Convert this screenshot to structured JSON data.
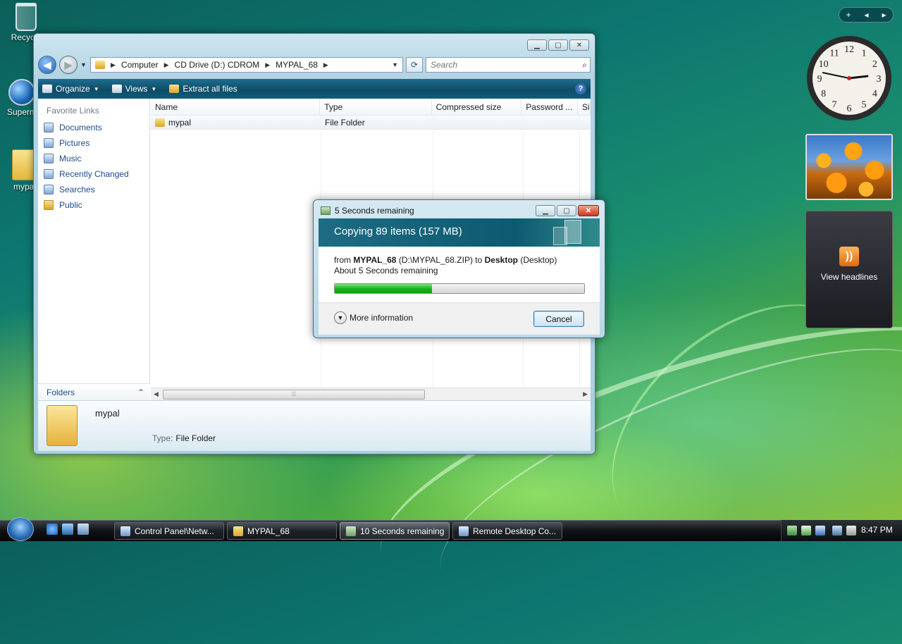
{
  "desktop": {
    "icons": [
      {
        "label": "Recycle"
      },
      {
        "label": "Superm"
      },
      {
        "label": "mypal"
      }
    ]
  },
  "explorer": {
    "address": [
      "Computer",
      "CD Drive (D:) CDROM",
      "MYPAL_68"
    ],
    "search_placeholder": "Search",
    "toolbar": {
      "organize": "Organize",
      "views": "Views",
      "extract": "Extract all files"
    },
    "favorite_links_heading": "Favorite Links",
    "favorite_links": [
      "Documents",
      "Pictures",
      "Music",
      "Recently Changed",
      "Searches",
      "Public"
    ],
    "folders_label": "Folders",
    "columns": [
      "Name",
      "Type",
      "Compressed size",
      "Password ...",
      "Si"
    ],
    "rows": [
      {
        "name": "mypal",
        "type": "File Folder"
      }
    ],
    "details": {
      "name": "mypal",
      "type_label": "Type:",
      "type_value": "File Folder"
    }
  },
  "copy_dialog": {
    "title": "5 Seconds remaining",
    "heading": "Copying 89 items (157 MB)",
    "from_prefix": "from ",
    "from_name": "MYPAL_68",
    "from_path": " (D:\\MYPAL_68.ZIP) to ",
    "to_name": "Desktop",
    "to_suffix": " (Desktop)",
    "remaining": "About 5 Seconds remaining",
    "progress_percent": 39,
    "more_info": "More information",
    "cancel": "Cancel"
  },
  "gadgets": {
    "toolbar_plus": "+",
    "clock_numbers": [
      "12",
      "1",
      "2",
      "3",
      "4",
      "5",
      "6",
      "7",
      "8",
      "9",
      "10",
      "11"
    ],
    "clock_time": {
      "hour": 2,
      "minute": 47
    },
    "feeds_label": "View headlines"
  },
  "taskbar": {
    "buttons": [
      "Control Panel\\Netw...",
      "MYPAL_68",
      "10 Seconds remaining",
      "Remote Desktop Co..."
    ],
    "time": "8:47 PM"
  },
  "colors": {
    "accent": "#0f5a72",
    "progress": "#1fb31f"
  }
}
